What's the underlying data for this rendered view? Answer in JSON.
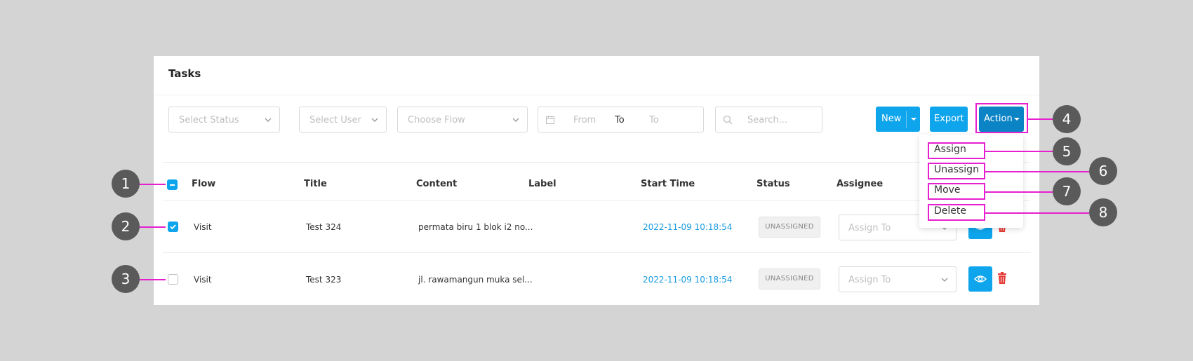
{
  "page": {
    "title": "Tasks"
  },
  "filters": {
    "status_placeholder": "Select Status",
    "user_placeholder": "Select User",
    "flow_placeholder": "Choose Flow",
    "date_from": "From",
    "date_separator": "To",
    "date_to": "To",
    "search_placeholder": "Search..."
  },
  "toolbar": {
    "new_label": "New",
    "export_label": "Export",
    "action_label": "Action"
  },
  "action_menu": {
    "items": [
      "Assign",
      "Unassign",
      "Move",
      "Delete"
    ]
  },
  "table": {
    "headers": {
      "flow": "Flow",
      "title": "Title",
      "content": "Content",
      "label": "Label",
      "start_time": "Start Time",
      "status": "Status",
      "assignee": "Assignee"
    },
    "rows": [
      {
        "flow": "Visit",
        "title": "Test 324",
        "content": "permata biru 1 blok i2 no...",
        "label": "",
        "start_time": "2022-11-09 10:18:54",
        "status": "UNASSIGNED",
        "assignee_placeholder": "Assign To",
        "checked": true
      },
      {
        "flow": "Visit",
        "title": "Test 323",
        "content": "jl. rawamangun muka sel...",
        "label": "",
        "start_time": "2022-11-09 10:18:54",
        "status": "UNASSIGNED",
        "assignee_placeholder": "Assign To",
        "checked": false
      }
    ]
  },
  "callouts": [
    "1",
    "2",
    "3",
    "4",
    "5",
    "6",
    "7",
    "8"
  ],
  "colors": {
    "primary": "#0ea5ec",
    "action": "#0b84c6",
    "highlight": "#e61fcf",
    "callout": "#5a5a5a",
    "danger": "#e53935",
    "link": "#1a9be0"
  },
  "icons": [
    "chevron-down-icon",
    "calendar-icon",
    "search-icon",
    "caret-down-icon",
    "eye-icon",
    "trash-icon",
    "minus-icon",
    "check-icon"
  ]
}
